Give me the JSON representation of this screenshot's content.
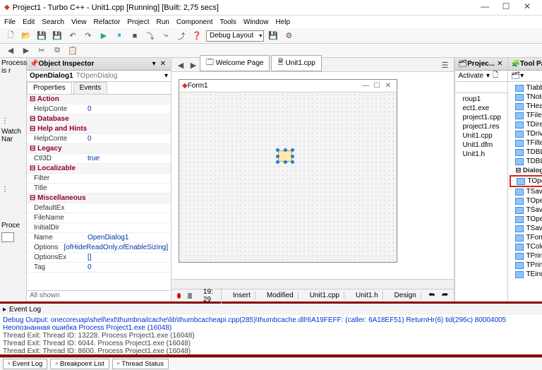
{
  "title": "Project1 - Turbo C++ - Unit1.cpp [Running] [Built: 2,75 secs]",
  "menu": [
    "File",
    "Edit",
    "Search",
    "View",
    "Refactor",
    "Project",
    "Run",
    "Component",
    "Tools",
    "Window",
    "Help"
  ],
  "layoutDropdown": "Debug Layout",
  "leftDock": {
    "structure": "Process is r",
    "watch": "Watch Nar",
    "proc": "Proce"
  },
  "objectInspector": {
    "title": "Object Inspector",
    "selector": {
      "name": "OpenDialog1",
      "type": "TOpenDialog"
    },
    "tabs": [
      "Properties",
      "Events"
    ],
    "activeTab": "Properties",
    "groups": [
      {
        "cat": "Action",
        "rows": [
          {
            "k": "HelpConte",
            "v": "0"
          }
        ]
      },
      {
        "cat": "Database",
        "rows": []
      },
      {
        "cat": "Help and Hints",
        "rows": [
          {
            "k": "HelpConte",
            "v": "0"
          }
        ]
      },
      {
        "cat": "Legacy",
        "rows": [
          {
            "k": "Ctl3D",
            "v": "true"
          }
        ]
      },
      {
        "cat": "Localizable",
        "rows": [
          {
            "k": "Filter",
            "v": ""
          },
          {
            "k": "Title",
            "v": ""
          }
        ]
      },
      {
        "cat": "Miscellaneous",
        "rows": [
          {
            "k": "DefaultEx",
            "v": ""
          },
          {
            "k": "FileName",
            "v": ""
          },
          {
            "k": "InitialDir",
            "v": ""
          },
          {
            "k": "Name",
            "v": "OpenDialog1"
          },
          {
            "k": "Options",
            "v": "[ofHideReadOnly,ofEnableSizing]"
          },
          {
            "k": "OptionsEx",
            "v": "[]"
          },
          {
            "k": "Tag",
            "v": "0"
          }
        ]
      }
    ],
    "footer": "All shown"
  },
  "editorTabs": [
    {
      "label": "Welcome Page"
    },
    {
      "label": "Unit1.cpp"
    }
  ],
  "formDesigner": {
    "title": "Form1"
  },
  "statusbar": {
    "pos": "19: 29",
    "mode": "Insert",
    "mod": "Modified",
    "file": "Unit1.cpp",
    "hdr": "Unit1.h",
    "view": "Design"
  },
  "projectPane": {
    "title": "Projec...",
    "activate": "Activate",
    "tree": [
      "roup1",
      " ect1.exe",
      "  project1.cpp",
      "  project1.res",
      "  Unit1.cpp",
      "  Unit1.dfm",
      "  Unit1.h"
    ]
  },
  "toolPalette": {
    "title": "Tool Pa...",
    "groups": [
      {
        "cat": "",
        "items": [
          "TIabbed...",
          "TNotebook",
          "THeader",
          "TFileListBox",
          "TDirectory...",
          "TDriveCo...",
          "TFilterCo...",
          "TDBLooku...",
          "TDBLooku..."
        ]
      },
      {
        "cat": "Dialogs",
        "items": [
          "TOpenDia...",
          "TSaveDialog",
          "TOpenPic...",
          "TSavePict...",
          "TOpenTe...",
          "TSaveTe...",
          "TFontDialog",
          "TColorDia...",
          "TPrintDialog",
          "TPrinterS...",
          "TEindDial"
        ]
      }
    ],
    "highlighted": "TOpenDia..."
  },
  "eventLog": {
    "title": "Event Log",
    "lines": [
      {
        "cls": "blue",
        "t": "Debug Output: onecoreuap\\shell\\ext\\thumbnailcache\\lib\\thumbcacheapi.cpp(285)\\thumbcache.dll!6A19FEFF: (caller: 6A18EF51) ReturnHr(6) tid(296c) 80004005 Неопознанная ошибка  Process Project1.exe (16048)"
      },
      {
        "cls": "",
        "t": "Thread Exit: Thread ID: 13228. Process Project1.exe (16048)"
      },
      {
        "cls": "",
        "t": "Thread Exit: Thread ID: 6044. Process Project1.exe (16048)"
      },
      {
        "cls": "",
        "t": "Thread Exit: Thread ID: 8600. Process Project1.exe (16048)"
      }
    ]
  },
  "bottomTabs": [
    "Event Log",
    "Breakpoint List",
    "Thread Status"
  ]
}
